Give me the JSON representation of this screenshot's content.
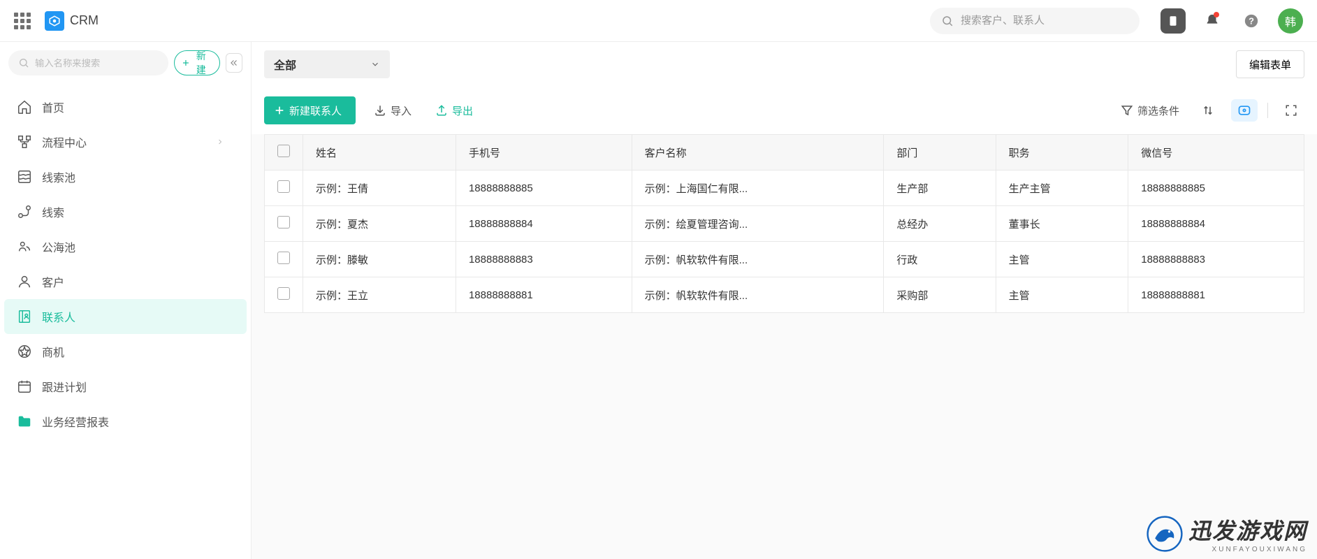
{
  "header": {
    "app_title": "CRM",
    "search_placeholder": "搜索客户、联系人",
    "avatar_label": "韩"
  },
  "sidebar": {
    "search_placeholder": "输入名称来搜索",
    "new_button": "新建",
    "items": [
      {
        "label": "首页"
      },
      {
        "label": "流程中心"
      },
      {
        "label": "线索池"
      },
      {
        "label": "线索"
      },
      {
        "label": "公海池"
      },
      {
        "label": "客户"
      },
      {
        "label": "联系人"
      },
      {
        "label": "商机"
      },
      {
        "label": "跟进计划"
      },
      {
        "label": "业务经营报表"
      }
    ]
  },
  "main": {
    "filter_label": "全部",
    "edit_form": "编辑表单",
    "new_contact": "新建联系人",
    "import": "导入",
    "export": "导出",
    "filter_conditions": "筛选条件",
    "table": {
      "headers": [
        "姓名",
        "手机号",
        "客户名称",
        "部门",
        "职务",
        "微信号"
      ],
      "rows": [
        {
          "c1": "示例：王倩",
          "c2": "18888888885",
          "c3": "示例：上海国仁有限...",
          "c4": "生产部",
          "c5": "生产主管",
          "c6": "18888888885"
        },
        {
          "c1": "示例：夏杰",
          "c2": "18888888884",
          "c3": "示例：绘夏管理咨询...",
          "c4": "总经办",
          "c5": "董事长",
          "c6": "18888888884"
        },
        {
          "c1": "示例：滕敏",
          "c2": "18888888883",
          "c3": "示例：帆软软件有限...",
          "c4": "行政",
          "c5": "主管",
          "c6": "18888888883"
        },
        {
          "c1": "示例：王立",
          "c2": "18888888881",
          "c3": "示例：帆软软件有限...",
          "c4": "采购部",
          "c5": "主管",
          "c6": "18888888881"
        }
      ]
    }
  },
  "watermark": {
    "title": "迅发游戏网",
    "subtitle": "XUNFAYOUXIWANG"
  }
}
